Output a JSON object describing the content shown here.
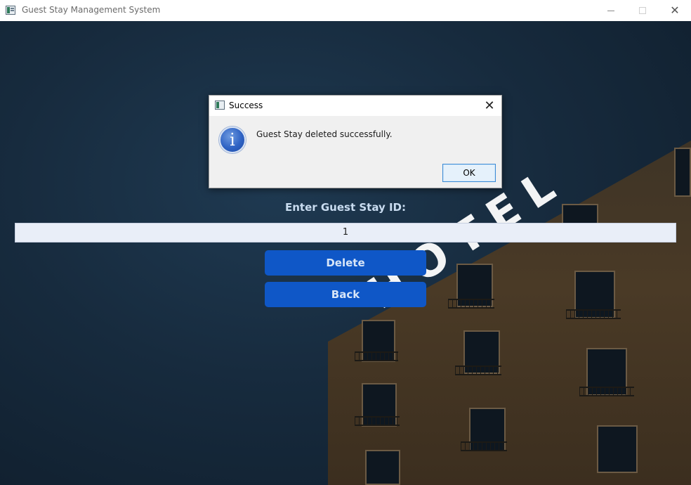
{
  "window": {
    "title": "Guest Stay Management System",
    "icon": "app-icon"
  },
  "background": {
    "sign_text": "HOTEL"
  },
  "form": {
    "label": "Enter Guest Stay ID:",
    "id_value": "1",
    "delete_label": "Delete",
    "back_label": "Back"
  },
  "dialog": {
    "title": "Success",
    "message": "Guest Stay deleted successfully.",
    "icon": "info-icon",
    "icon_glyph": "i",
    "ok_label": "OK",
    "close_glyph": "✕"
  },
  "colors": {
    "button": "#0f57c7",
    "label": "#c9dcf0",
    "field": "#e9eef8"
  }
}
